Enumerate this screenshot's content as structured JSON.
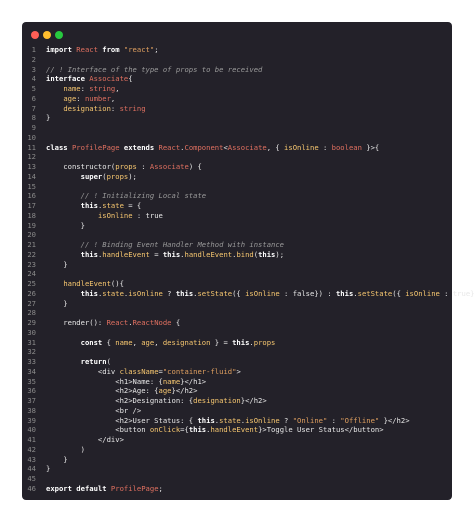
{
  "window": {
    "controls": [
      "close",
      "minimize",
      "maximize"
    ]
  },
  "code_lines": [
    {
      "n": "1",
      "text": "import React from \"react\";"
    },
    {
      "n": "2",
      "text": ""
    },
    {
      "n": "3",
      "text": "// ! Interface of the type of props to be received"
    },
    {
      "n": "4",
      "text": "interface Associate{"
    },
    {
      "n": "5",
      "text": "    name: string,"
    },
    {
      "n": "6",
      "text": "    age: number,"
    },
    {
      "n": "7",
      "text": "    designation: string"
    },
    {
      "n": "8",
      "text": "}"
    },
    {
      "n": "9",
      "text": ""
    },
    {
      "n": "10",
      "text": ""
    },
    {
      "n": "11",
      "text": "class ProfilePage extends React.Component<Associate, { isOnline : boolean }>{"
    },
    {
      "n": "12",
      "text": ""
    },
    {
      "n": "13",
      "text": "    constructor(props : Associate) {"
    },
    {
      "n": "14",
      "text": "        super(props);"
    },
    {
      "n": "15",
      "text": ""
    },
    {
      "n": "16",
      "text": "        // ! Initializing Local state"
    },
    {
      "n": "17",
      "text": "        this.state = {"
    },
    {
      "n": "18",
      "text": "            isOnline : true"
    },
    {
      "n": "19",
      "text": "        }"
    },
    {
      "n": "20",
      "text": ""
    },
    {
      "n": "21",
      "text": "        // ! Binding Event Handler Method with instance"
    },
    {
      "n": "22",
      "text": "        this.handleEvent = this.handleEvent.bind(this);"
    },
    {
      "n": "23",
      "text": "    }"
    },
    {
      "n": "24",
      "text": ""
    },
    {
      "n": "25",
      "text": "    handleEvent(){"
    },
    {
      "n": "26",
      "text": "        this.state.isOnline ? this.setState({ isOnline : false}) : this.setState({ isOnline : true})"
    },
    {
      "n": "27",
      "text": "    }"
    },
    {
      "n": "28",
      "text": ""
    },
    {
      "n": "29",
      "text": "    render(): React.ReactNode {"
    },
    {
      "n": "30",
      "text": ""
    },
    {
      "n": "31",
      "text": "        const { name, age, designation } = this.props"
    },
    {
      "n": "32",
      "text": ""
    },
    {
      "n": "33",
      "text": "        return("
    },
    {
      "n": "34",
      "text": "            <div className=\"container-fluid\">"
    },
    {
      "n": "35",
      "text": "                <h1>Name: {name}</h1>"
    },
    {
      "n": "36",
      "text": "                <h2>Age: {age}</h2>"
    },
    {
      "n": "37",
      "text": "                <h2>Designation: {designation}</h2>"
    },
    {
      "n": "38",
      "text": "                <br />"
    },
    {
      "n": "39",
      "text": "                <h2>User Status: { this.state.isOnline ? \"Online\" : \"Offline\" }</h2>"
    },
    {
      "n": "40",
      "text": "                <button onClick={this.handleEvent}>Toggle User Status</button>"
    },
    {
      "n": "41",
      "text": "            </div>"
    },
    {
      "n": "42",
      "text": "        )"
    },
    {
      "n": "43",
      "text": "    }"
    },
    {
      "n": "44",
      "text": "}"
    },
    {
      "n": "45",
      "text": ""
    },
    {
      "n": "46",
      "text": "export default ProfilePage;"
    }
  ]
}
